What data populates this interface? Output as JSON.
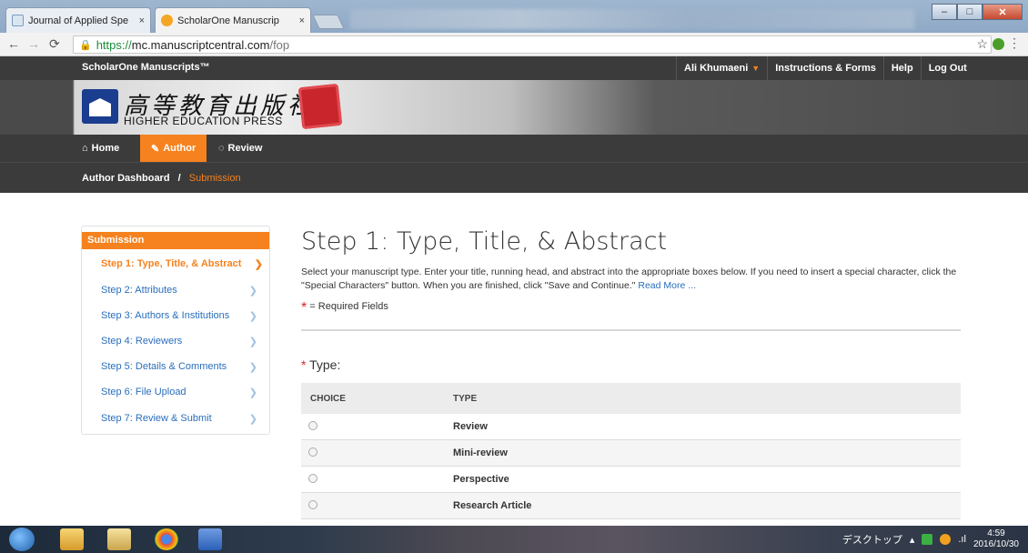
{
  "browser": {
    "tabs": [
      {
        "title": "Journal of Applied Spe",
        "active": false
      },
      {
        "title": "ScholarOne Manuscrip",
        "active": true
      }
    ],
    "close_glyph": "×",
    "url_scheme": "https://",
    "url_host": "mc.manuscriptcentral.com",
    "url_path": "/fop",
    "window_buttons": [
      "–",
      "□",
      "✕"
    ]
  },
  "topbar": {
    "brand": "ScholarOne Manuscripts™",
    "user": "Ali Khumaeni",
    "links": [
      "Instructions & Forms",
      "Help",
      "Log Out"
    ]
  },
  "banner": {
    "chinese_name": "高等教育出版社",
    "english_name": "HIGHER EDUCATION PRESS"
  },
  "mainnav": {
    "home": "Home",
    "author": "Author",
    "review": "Review"
  },
  "breadcrumb": {
    "root": "Author Dashboard",
    "separator": "/",
    "current": "Submission"
  },
  "sidebar": {
    "heading": "Submission",
    "steps": [
      "Step 1: Type, Title, & Abstract",
      "Step 2: Attributes",
      "Step 3: Authors & Institutions",
      "Step 4: Reviewers",
      "Step 5: Details & Comments",
      "Step 6: File Upload",
      "Step 7: Review & Submit"
    ],
    "current_step": 0
  },
  "main": {
    "title": "Step 1: Type, Title, & Abstract",
    "intro": "Select your manuscript type. Enter your title, running head, and abstract into the appropriate boxes below. If you need to insert a special character, click the \"Special Characters\" button. When you are finished, click \"Save and Continue.\"",
    "read_more": "Read More ...",
    "required_note": "= Required Fields",
    "type_label": "Type:",
    "table_headers": [
      "CHOICE",
      "TYPE"
    ],
    "types": [
      "Review",
      "Mini-review",
      "Perspective",
      "Research Article"
    ]
  },
  "taskbar": {
    "desktop_label": "デスクトップ",
    "time": "4:59",
    "date": "2016/10/30"
  },
  "colors": {
    "accent": "#f5821f",
    "dark": "#3b3b3b",
    "link": "#2a6ebb"
  }
}
